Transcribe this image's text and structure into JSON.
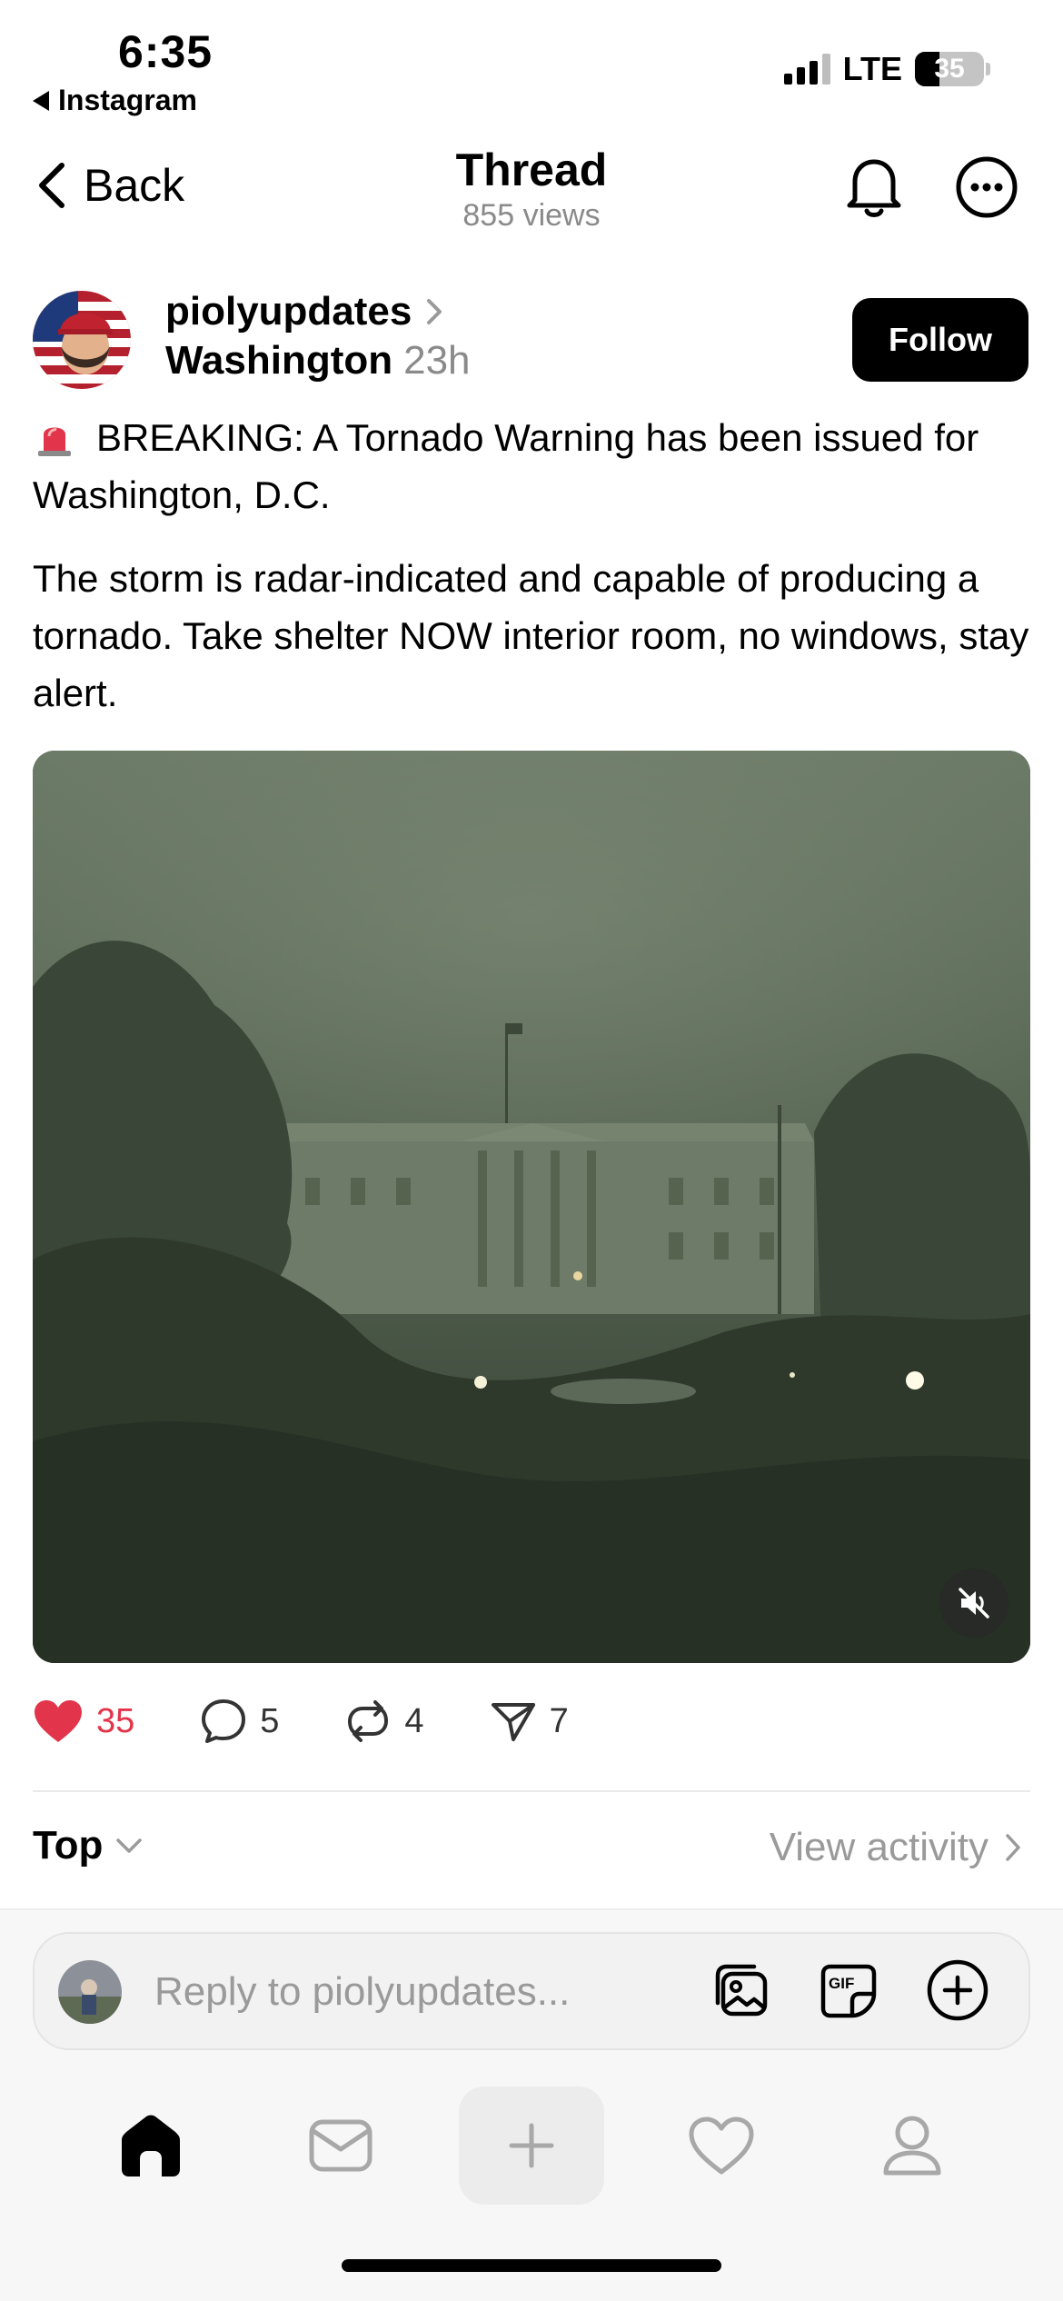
{
  "status_bar": {
    "time": "6:35",
    "back_app": "Instagram",
    "network": "LTE",
    "battery": "35"
  },
  "header": {
    "back_label": "Back",
    "title": "Thread",
    "subtitle": "855 views"
  },
  "post": {
    "username": "piolyupdates",
    "location": "Washington",
    "time": "23h",
    "follow_label": "Follow",
    "paragraph_1": "BREAKING: A Tornado Warning has been issued for Washington, D.C.",
    "paragraph_2": "The storm is radar-indicated and capable of producing a tornado. Take shelter NOW interior room, no windows, stay alert.",
    "media_icon": "mute-icon"
  },
  "actions": {
    "likes": "35",
    "comments": "5",
    "reposts": "4",
    "shares": "7"
  },
  "replies_bar": {
    "sort_label": "Top",
    "activity_label": "View activity"
  },
  "composer": {
    "placeholder": "Reply to piolyupdates..."
  },
  "tab_bar": {
    "items": [
      "home-icon",
      "inbox-icon",
      "create-icon",
      "activity-heart-icon",
      "profile-icon"
    ]
  },
  "colors": {
    "like": "#e2344a",
    "muted_text": "#8a8a8a"
  }
}
